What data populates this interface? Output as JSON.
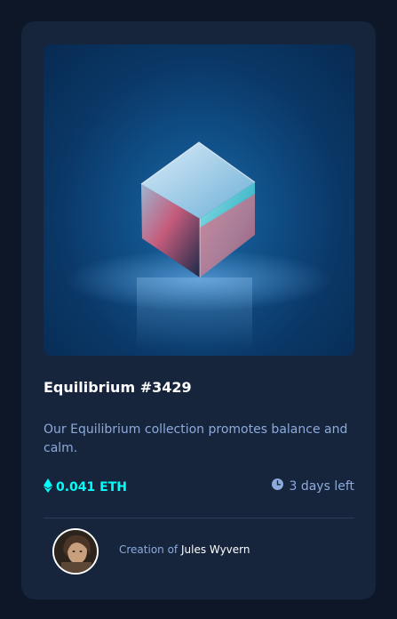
{
  "card": {
    "title": "Equilibrium #3429",
    "description": "Our Equilibrium collection promotes balance and calm.",
    "price": "0.041 ETH",
    "time_left": "3 days left",
    "creator_prefix": "Creation of",
    "creator_name": "Jules Wyvern"
  },
  "icons": {
    "price": "ethereum-icon",
    "time": "clock-icon"
  },
  "colors": {
    "page_bg": "#0d1727",
    "card_bg": "#16243c",
    "accent_cyan": "#00fff8",
    "soft_blue": "#8cabdc",
    "white": "#ffffff",
    "divider": "#2e3d55"
  }
}
